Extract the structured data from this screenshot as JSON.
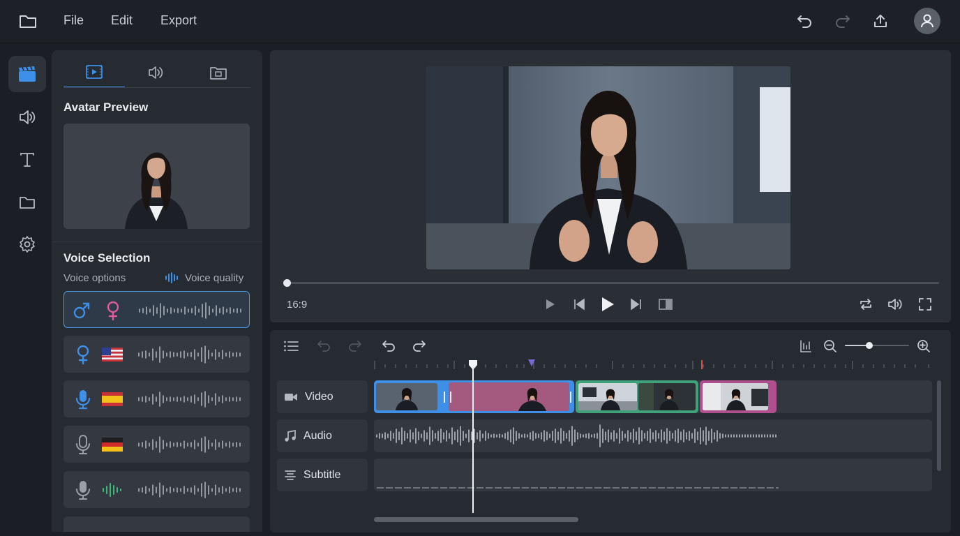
{
  "menu": {
    "file": "File",
    "edit": "Edit",
    "export": "Export"
  },
  "panel": {
    "avatar_preview_title": "Avatar Preview",
    "voice_selection_title": "Voice Selection",
    "voice_options_label": "Voice options",
    "voice_quality_label": "Voice quality",
    "voices": [
      {
        "icons": [
          "male-symbol-icon",
          "female-symbol-icon"
        ],
        "selected": true
      },
      {
        "icons": [
          "female-symbol-icon",
          "us-flag-icon"
        ],
        "selected": false
      },
      {
        "icons": [
          "microphone-icon",
          "spain-flag-icon"
        ],
        "selected": false
      },
      {
        "icons": [
          "microphone-icon",
          "germany-flag-icon"
        ],
        "selected": false
      },
      {
        "icons": [
          "microphone-icon",
          "green-waveform-icon"
        ],
        "selected": false
      }
    ]
  },
  "player": {
    "aspect_ratio": "16:9",
    "progress": 0
  },
  "timeline": {
    "tracks": [
      {
        "name": "Video",
        "icon": "video-camera-icon"
      },
      {
        "name": "Audio",
        "icon": "music-note-icon"
      },
      {
        "name": "Subtitle",
        "icon": "text-align-icon"
      }
    ]
  },
  "colors": {
    "accent": "#3d8fe8",
    "clip_pink": "#a35a7e",
    "clip_green": "#3fa27a",
    "clip_magenta": "#b04f8e",
    "marker_purple": "#7a67d8",
    "marker_red": "#e0504a"
  }
}
